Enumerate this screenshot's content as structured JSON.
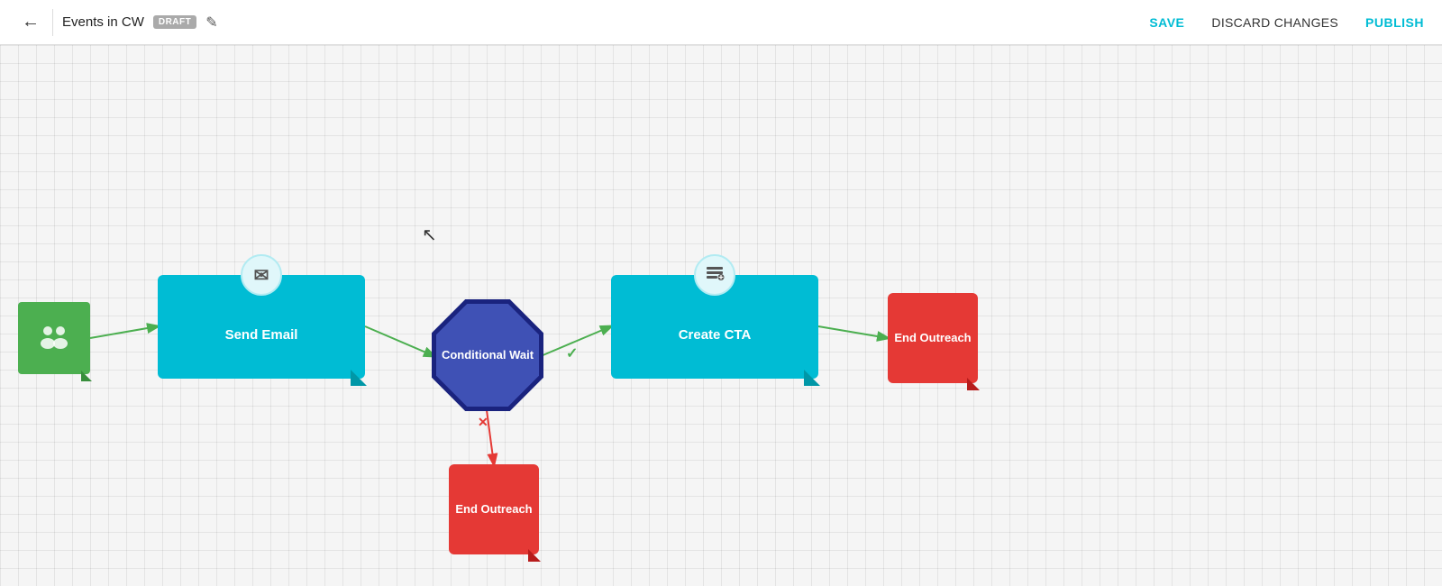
{
  "header": {
    "back_label": "←",
    "title": "Events in CW",
    "draft_badge": "DRAFT",
    "edit_icon": "✎",
    "save_label": "SAVE",
    "discard_label": "DISCARD CHANGES",
    "publish_label": "PUBLISH"
  },
  "nodes": {
    "send_email": {
      "label": "Send Email",
      "icon": "✉"
    },
    "conditional_wait": {
      "label": "Conditional Wait",
      "icon": "≡"
    },
    "create_cta": {
      "label": "Create CTA",
      "icon": "≡+"
    },
    "end_outreach_1": {
      "label": "End Outreach"
    },
    "end_outreach_2": {
      "label": "End Outreach"
    }
  }
}
